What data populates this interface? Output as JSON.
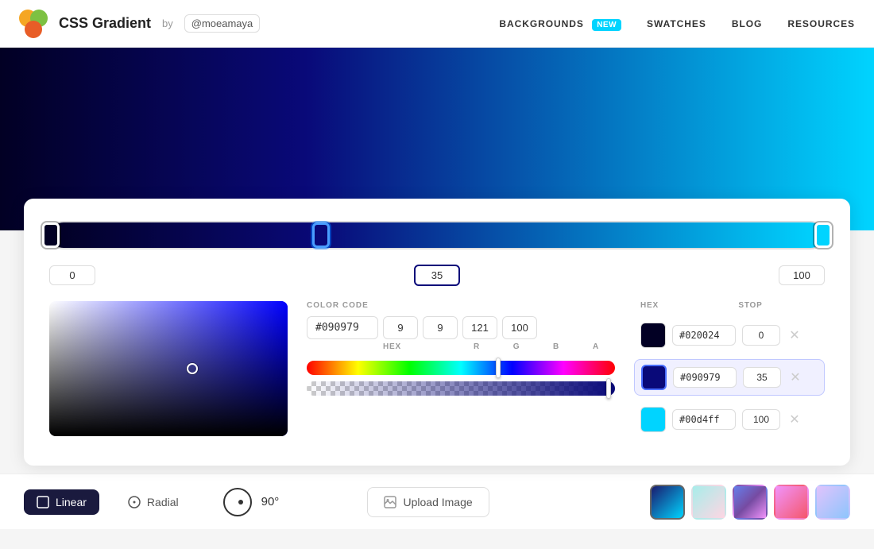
{
  "header": {
    "logo_text": "CSS Gradient",
    "logo_by": "by",
    "logo_user": "@moeamaya",
    "nav": [
      {
        "label": "BACKGROUNDS",
        "badge": "NEW"
      },
      {
        "label": "SWATCHES"
      },
      {
        "label": "BLOG"
      },
      {
        "label": "RESOURCES"
      }
    ]
  },
  "gradient": {
    "type": "linear",
    "angle": "90°",
    "stops": [
      {
        "hex": "#020024",
        "position": 0,
        "color": "#020024"
      },
      {
        "hex": "#090979",
        "position": 35,
        "color": "#090979"
      },
      {
        "hex": "#00d4ff",
        "position": 100,
        "color": "#00d4ff"
      }
    ],
    "active_stop_index": 1
  },
  "color_picker": {
    "label": "COLOR CODE",
    "hex_value": "#090979",
    "r": "9",
    "g": "9",
    "b": "121",
    "a": "100",
    "hex_label": "HEX",
    "r_label": "R",
    "g_label": "G",
    "b_label": "B",
    "a_label": "A"
  },
  "stop_labels": {
    "first": "0",
    "middle": "35",
    "last": "100"
  },
  "stops_panel": {
    "hex_label": "HEX",
    "stop_label": "STOP",
    "rows": [
      {
        "hex": "#020024",
        "position": "0",
        "color": "#020024"
      },
      {
        "hex": "#090979",
        "position": "35",
        "color": "#090979",
        "active": true
      },
      {
        "hex": "#00d4ff",
        "position": "100",
        "color": "#00d4ff"
      }
    ]
  },
  "bottom_bar": {
    "linear_label": "Linear",
    "radial_label": "Radial",
    "angle_value": "90°",
    "upload_label": "Upload Image",
    "presets": [
      {
        "gradient": "linear-gradient(135deg, #1a1a6e, #00d4ff)",
        "selected": true
      },
      {
        "gradient": "linear-gradient(135deg, #a8edea, #fed6e3)"
      },
      {
        "gradient": "linear-gradient(135deg, #667eea, #764ba2, #f093fb)"
      },
      {
        "gradient": "linear-gradient(135deg, #f093fb, #f5576c)"
      },
      {
        "gradient": "linear-gradient(135deg, #e0c3fc, #8ec5fc)"
      }
    ]
  }
}
